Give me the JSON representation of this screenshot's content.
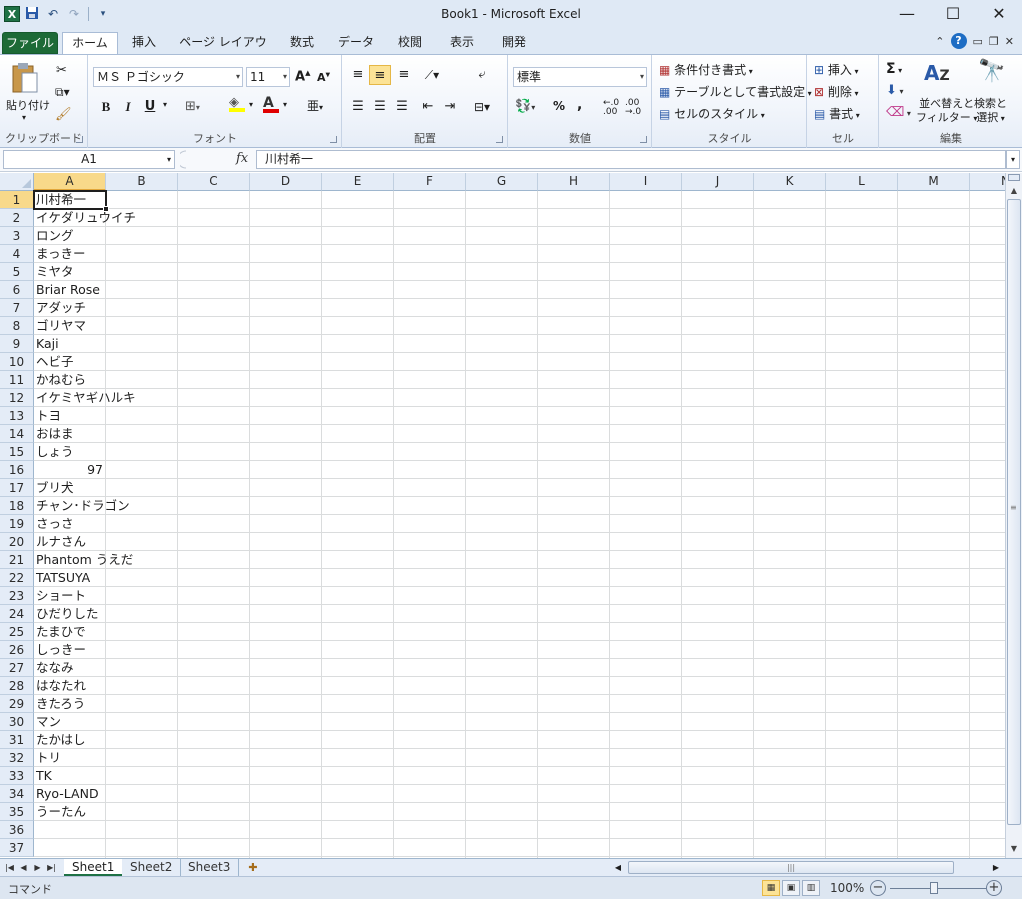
{
  "window": {
    "title": "Book1 - Microsoft Excel"
  },
  "tabs": {
    "file": "ファイル",
    "items": [
      "ホーム",
      "挿入",
      "ページ レイアウト",
      "数式",
      "データ",
      "校閲",
      "表示",
      "開発"
    ]
  },
  "ribbon": {
    "clipboard": {
      "paste": "貼り付け",
      "label": "クリップボード"
    },
    "font": {
      "name": "ＭＳ Ｐゴシック",
      "size": "11",
      "bold": "B",
      "italic": "I",
      "underline": "U",
      "label": "フォント"
    },
    "alignment": {
      "label": "配置"
    },
    "number": {
      "format": "標準",
      "percent": "%",
      "comma": ",",
      "label": "数値"
    },
    "styles": {
      "conditional": "条件付き書式",
      "table": "テーブルとして書式設定",
      "cell": "セルのスタイル",
      "label": "スタイル"
    },
    "cells": {
      "insert": "挿入",
      "delete": "削除",
      "format": "書式",
      "label": "セル"
    },
    "editing": {
      "sort1": "並べ替えと",
      "sort2": "フィルター",
      "find1": "検索と",
      "find2": "選択",
      "label": "編集"
    }
  },
  "formula_bar": {
    "name_box": "A1",
    "fx": "fx",
    "value": "川村希一"
  },
  "columns": [
    "A",
    "B",
    "C",
    "D",
    "E",
    "F",
    "G",
    "H",
    "I",
    "J",
    "K",
    "L",
    "M",
    "N"
  ],
  "rows": [
    {
      "n": "1",
      "a": "川村希一"
    },
    {
      "n": "2",
      "a": "イケダリュウイチ"
    },
    {
      "n": "3",
      "a": "ロング"
    },
    {
      "n": "4",
      "a": "まっきー"
    },
    {
      "n": "5",
      "a": "ミヤタ"
    },
    {
      "n": "6",
      "a": "Briar Rose"
    },
    {
      "n": "7",
      "a": "アダッチ"
    },
    {
      "n": "8",
      "a": "ゴリヤマ"
    },
    {
      "n": "9",
      "a": "Kaji"
    },
    {
      "n": "10",
      "a": "ヘビ子"
    },
    {
      "n": "11",
      "a": "かねむら"
    },
    {
      "n": "12",
      "a": "イケミヤギハルキ"
    },
    {
      "n": "13",
      "a": "トヨ"
    },
    {
      "n": "14",
      "a": "おはま"
    },
    {
      "n": "15",
      "a": "しょう"
    },
    {
      "n": "16",
      "a": "97"
    },
    {
      "n": "17",
      "a": "ブリ犬"
    },
    {
      "n": "18",
      "a": "チャン･ドラゴン"
    },
    {
      "n": "19",
      "a": "さっさ"
    },
    {
      "n": "20",
      "a": "ルナさん"
    },
    {
      "n": "21",
      "a": "Phantom うえだ"
    },
    {
      "n": "22",
      "a": "TATSUYA"
    },
    {
      "n": "23",
      "a": "ショート"
    },
    {
      "n": "24",
      "a": "ひだりした"
    },
    {
      "n": "25",
      "a": "たまひで"
    },
    {
      "n": "26",
      "a": "しっきー"
    },
    {
      "n": "27",
      "a": "ななみ"
    },
    {
      "n": "28",
      "a": "はなたれ"
    },
    {
      "n": "29",
      "a": "きたろう"
    },
    {
      "n": "30",
      "a": "マン"
    },
    {
      "n": "31",
      "a": "たかはし"
    },
    {
      "n": "32",
      "a": "トリ"
    },
    {
      "n": "33",
      "a": "TK"
    },
    {
      "n": "34",
      "a": "Ryo-LAND"
    },
    {
      "n": "35",
      "a": "うーたん"
    },
    {
      "n": "36",
      "a": ""
    },
    {
      "n": "37",
      "a": ""
    }
  ],
  "sheets": [
    "Sheet1",
    "Sheet2",
    "Sheet3"
  ],
  "status": {
    "mode": "コマンド",
    "zoom": "100%"
  }
}
